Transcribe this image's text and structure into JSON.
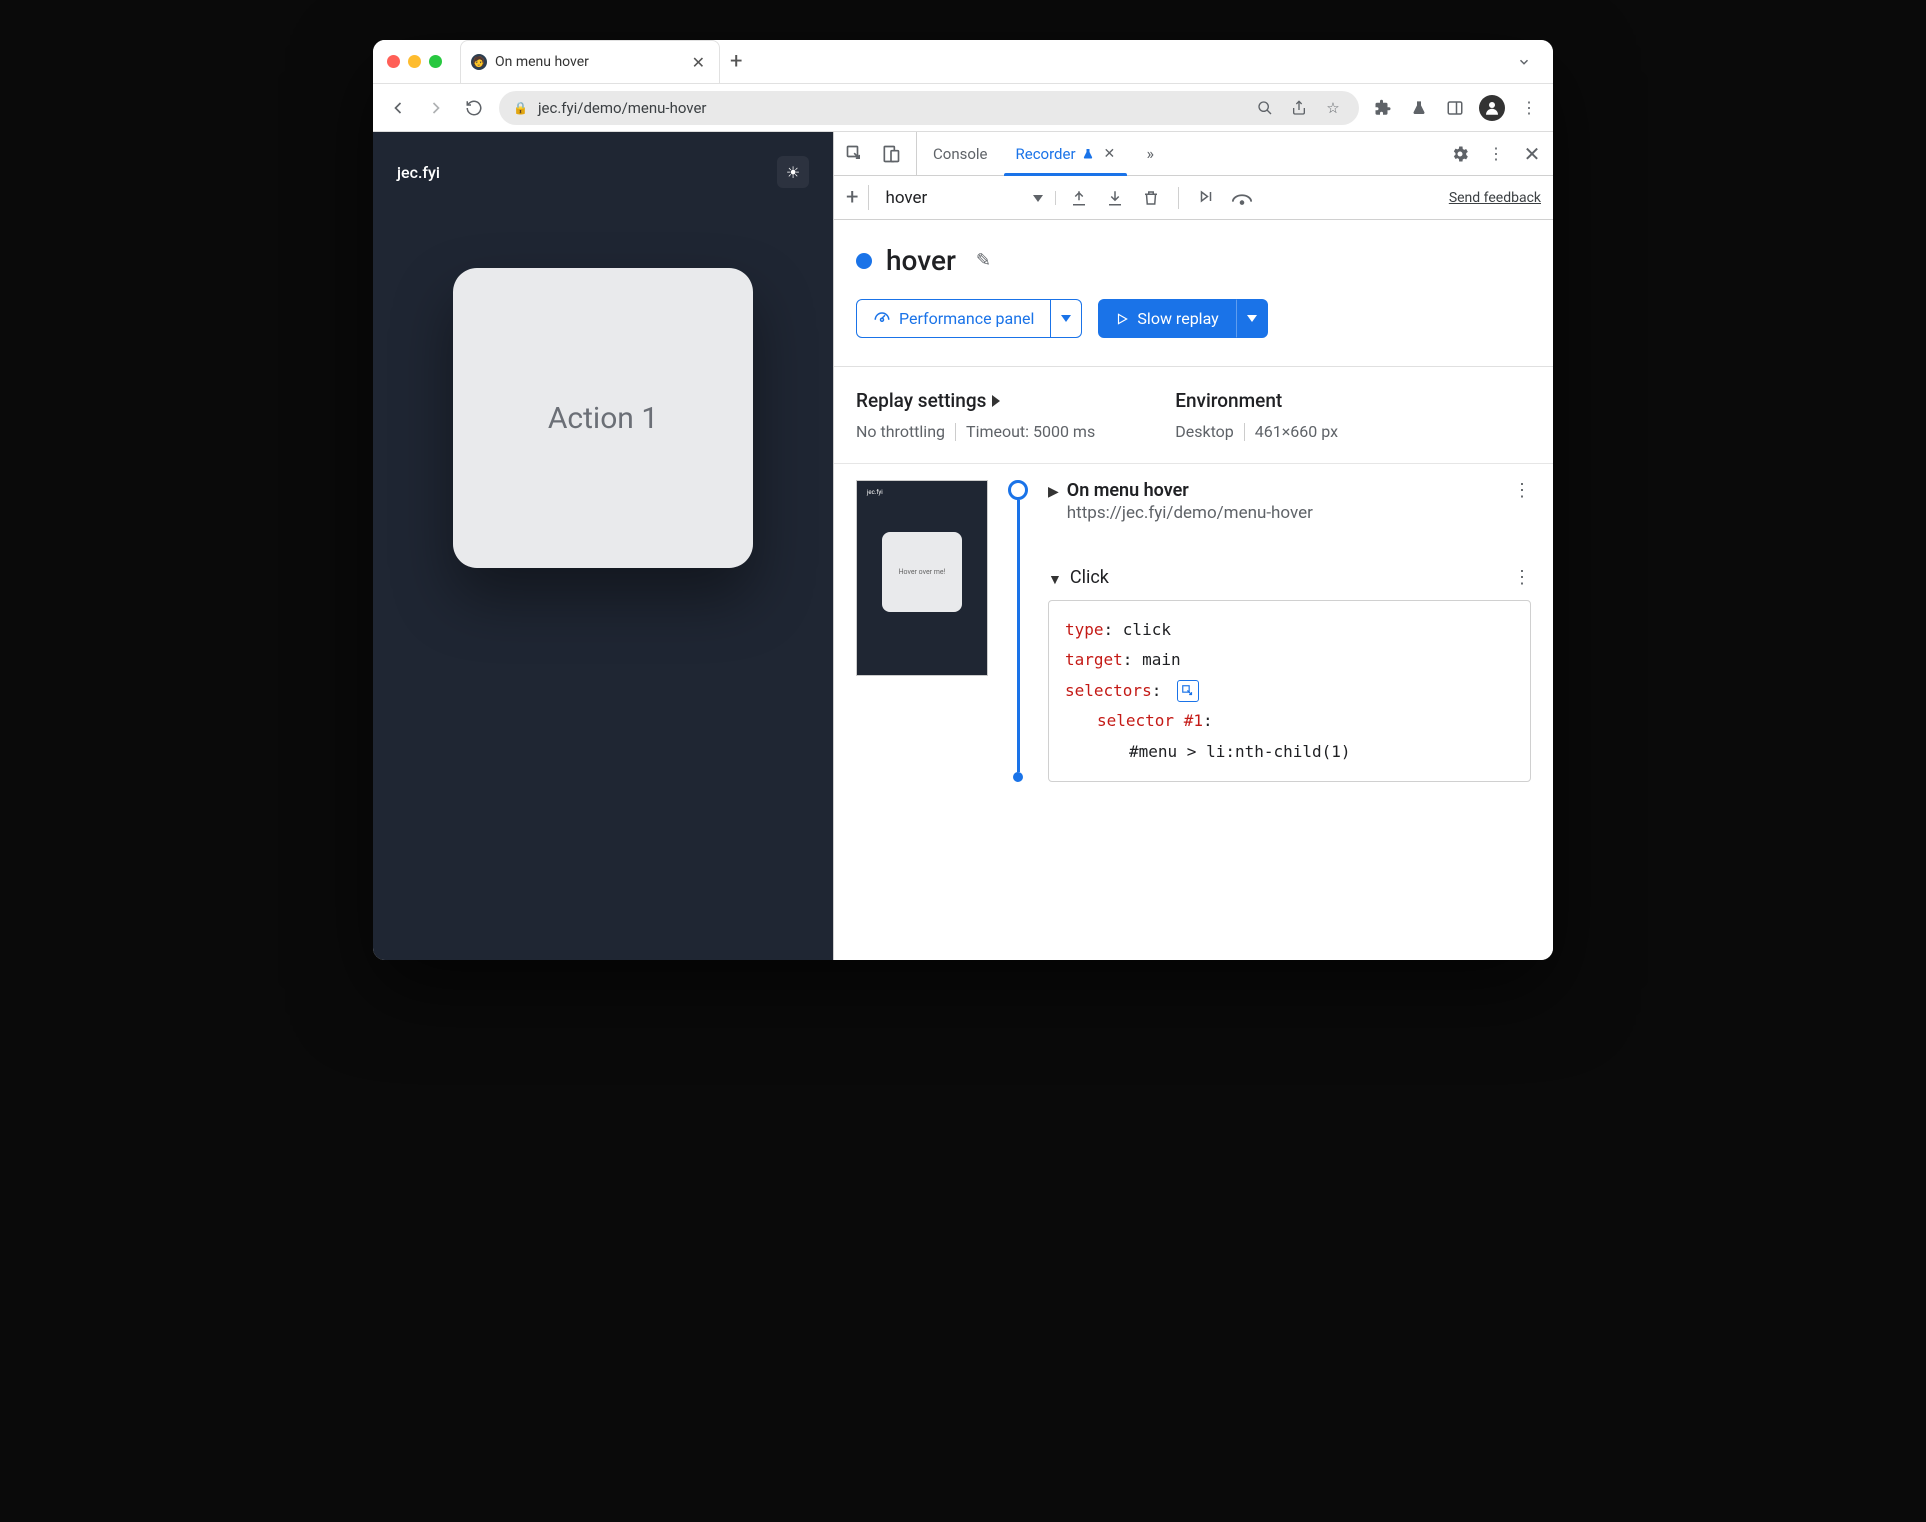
{
  "browser": {
    "tab": {
      "title": "On menu hover"
    },
    "url": "jec.fyi/demo/menu-hover"
  },
  "page": {
    "logo": "jec.fyi",
    "card": "Action 1",
    "thumb_label": "Hover over me!"
  },
  "devtools": {
    "tabs": {
      "console": "Console",
      "recorder": "Recorder"
    },
    "toolbar": {
      "recording_name": "hover",
      "feedback": "Send feedback"
    },
    "title": "hover",
    "buttons": {
      "perf": "Performance panel",
      "replay": "Slow replay"
    },
    "settings": {
      "replay_h": "Replay settings",
      "throttle": "No throttling",
      "timeout": "Timeout: 5000 ms",
      "env_h": "Environment",
      "device": "Desktop",
      "viewport": "461×660 px"
    },
    "steps": {
      "nav_title": "On menu hover",
      "nav_url": "https://jec.fyi/demo/menu-hover",
      "click_title": "Click",
      "code": {
        "type_k": "type",
        "type_v": ": click",
        "target_k": "target",
        "target_v": ": main",
        "selectors_k": "selectors",
        "selectors_v": ":",
        "selector_label": "selector #1",
        "selector_val": "#menu > li:nth-child(1)"
      }
    }
  }
}
